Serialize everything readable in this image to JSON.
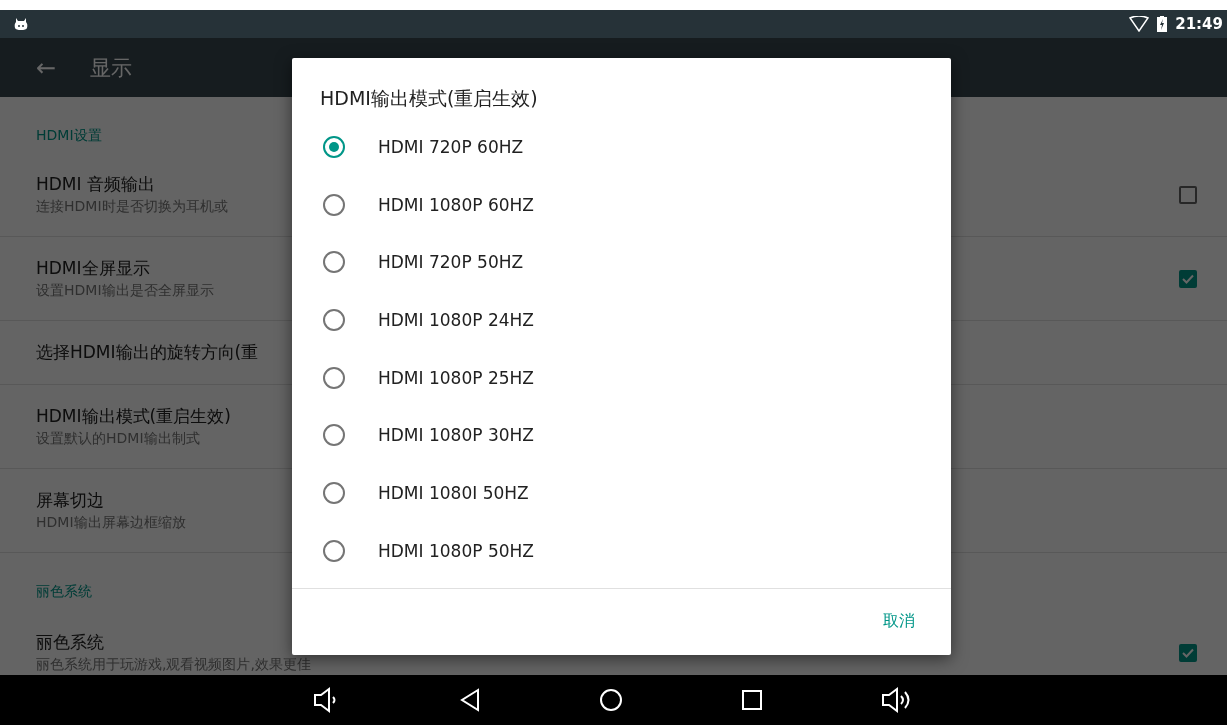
{
  "status_bar": {
    "time": "21:49"
  },
  "toolbar": {
    "back_icon": "←",
    "title": "显示"
  },
  "settings": [
    {
      "kind": "header",
      "title": "HDMI设置"
    },
    {
      "kind": "checkbox",
      "title": "HDMI 音频输出",
      "summary": "连接HDMI时是否切换为耳机或",
      "checked": false
    },
    {
      "kind": "checkbox",
      "title": "HDMI全屏显示",
      "summary": "设置HDMI输出是否全屏显示",
      "checked": true
    },
    {
      "kind": "plain",
      "title": "选择HDMI输出的旋转方向(重"
    },
    {
      "kind": "plain",
      "title": "HDMI输出模式(重启生效)",
      "summary": "设置默认的HDMI输出制式"
    },
    {
      "kind": "plain",
      "title": "屏幕切边",
      "summary": "HDMI输出屏幕边框缩放"
    },
    {
      "kind": "header",
      "title": "丽色系统"
    },
    {
      "kind": "checkbox",
      "title": "丽色系统",
      "summary": "丽色系统用于玩游戏,观看视频图片,效果更佳",
      "checked": true
    }
  ],
  "dialog": {
    "title": "HDMI输出模式(重启生效)",
    "options": [
      {
        "label": "HDMI 720P 60HZ",
        "selected": true
      },
      {
        "label": "HDMI 1080P 60HZ",
        "selected": false
      },
      {
        "label": "HDMI 720P 50HZ",
        "selected": false
      },
      {
        "label": "HDMI 1080P 24HZ",
        "selected": false
      },
      {
        "label": "HDMI 1080P 25HZ",
        "selected": false
      },
      {
        "label": "HDMI 1080P 30HZ",
        "selected": false
      },
      {
        "label": "HDMI 1080I 50HZ",
        "selected": false
      },
      {
        "label": "HDMI 1080P 50HZ",
        "selected": false
      }
    ],
    "cancel": "取消"
  }
}
